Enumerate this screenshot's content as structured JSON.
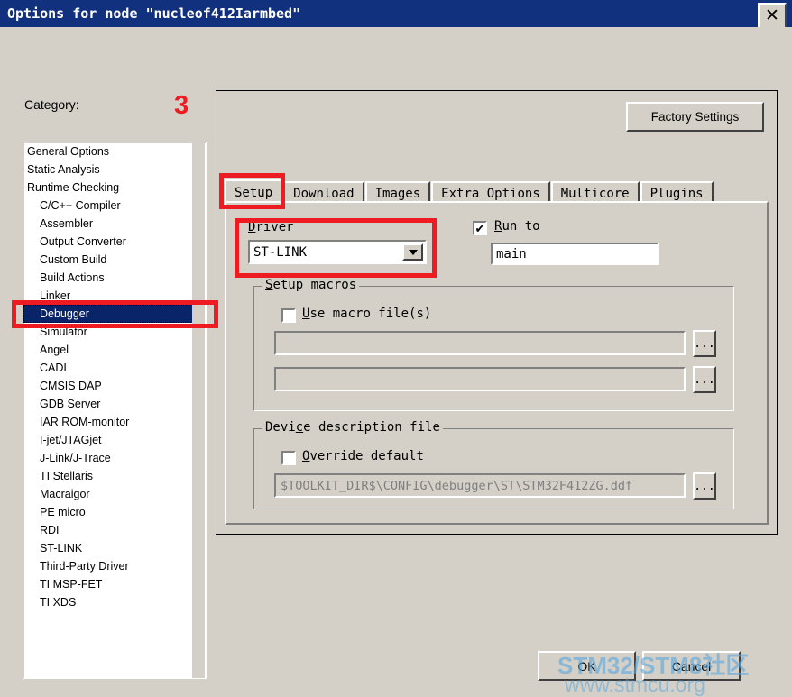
{
  "window": {
    "title": "Options for node \"nucleof412Iarmbed\"",
    "close_icon": "close-icon",
    "close_glyph": "✕"
  },
  "colors": {
    "titlebar": "#11307e",
    "face": "#d4d0c8",
    "selection": "#0a246a",
    "annotation_red": "#ee1c22",
    "watermark_blue": "#5da9dd"
  },
  "sidebar": {
    "label": "Category:",
    "marker": "3",
    "items": [
      {
        "label": "General Options",
        "indent": false,
        "selected": false
      },
      {
        "label": "Static Analysis",
        "indent": false,
        "selected": false
      },
      {
        "label": "Runtime Checking",
        "indent": false,
        "selected": false
      },
      {
        "label": "C/C++ Compiler",
        "indent": true,
        "selected": false
      },
      {
        "label": "Assembler",
        "indent": true,
        "selected": false
      },
      {
        "label": "Output Converter",
        "indent": true,
        "selected": false
      },
      {
        "label": "Custom Build",
        "indent": true,
        "selected": false
      },
      {
        "label": "Build Actions",
        "indent": true,
        "selected": false
      },
      {
        "label": "Linker",
        "indent": true,
        "selected": false
      },
      {
        "label": "Debugger",
        "indent": true,
        "selected": true
      },
      {
        "label": "Simulator",
        "indent": true,
        "selected": false
      },
      {
        "label": "Angel",
        "indent": true,
        "selected": false
      },
      {
        "label": "CADI",
        "indent": true,
        "selected": false
      },
      {
        "label": "CMSIS DAP",
        "indent": true,
        "selected": false
      },
      {
        "label": "GDB Server",
        "indent": true,
        "selected": false
      },
      {
        "label": "IAR ROM-monitor",
        "indent": true,
        "selected": false
      },
      {
        "label": "I-jet/JTAGjet",
        "indent": true,
        "selected": false
      },
      {
        "label": "J-Link/J-Trace",
        "indent": true,
        "selected": false
      },
      {
        "label": "TI Stellaris",
        "indent": true,
        "selected": false
      },
      {
        "label": "Macraigor",
        "indent": true,
        "selected": false
      },
      {
        "label": "PE micro",
        "indent": true,
        "selected": false
      },
      {
        "label": "RDI",
        "indent": true,
        "selected": false
      },
      {
        "label": "ST-LINK",
        "indent": true,
        "selected": false
      },
      {
        "label": "Third-Party Driver",
        "indent": true,
        "selected": false
      },
      {
        "label": "TI MSP-FET",
        "indent": true,
        "selected": false
      },
      {
        "label": "TI XDS",
        "indent": true,
        "selected": false
      }
    ]
  },
  "panel": {
    "factory_settings_label": "Factory Settings",
    "tabs": [
      {
        "label": "Setup",
        "active": true
      },
      {
        "label": "Download",
        "active": false
      },
      {
        "label": "Images",
        "active": false
      },
      {
        "label": "Extra Options",
        "active": false
      },
      {
        "label": "Multicore",
        "active": false
      },
      {
        "label": "Plugins",
        "active": false
      }
    ]
  },
  "setup": {
    "driver": {
      "label_prefix": "D",
      "label_rest": "river",
      "value": "ST-LINK",
      "arrow_icon": "chevron-down-icon"
    },
    "run_to": {
      "label_prefix": "R",
      "label_rest": "un to",
      "checked": true,
      "check_glyph": "✔",
      "value": "main"
    },
    "setup_macros": {
      "legend_prefix": "S",
      "legend_rest": "etup macros",
      "use_macro_prefix": "U",
      "use_macro_rest": "se macro file(s)",
      "use_macro_checked": false,
      "field1": "",
      "field2": "",
      "browse_label": "..."
    },
    "device_description": {
      "legend_prefix": "Devi",
      "legend_mid": "c",
      "legend_rest": "e description file",
      "override_prefix": "O",
      "override_rest": "verride default",
      "override_checked": false,
      "path": "$TOOLKIT_DIR$\\CONFIG\\debugger\\ST\\STM32F412ZG.ddf",
      "browse_label": "..."
    }
  },
  "buttons": {
    "ok": "OK",
    "cancel": "Cancel"
  },
  "watermark": {
    "line1": "STM32/STM8社区",
    "line2": "www.stmcu.org"
  }
}
